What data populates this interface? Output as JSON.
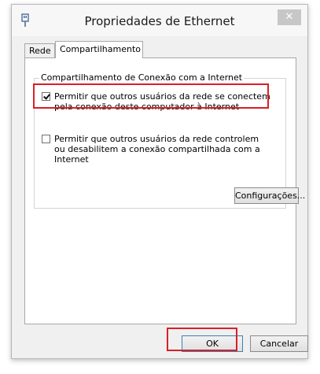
{
  "window": {
    "title": "Propriedades de Ethernet",
    "close_icon": "close-icon"
  },
  "tabs": [
    {
      "label": "Rede"
    },
    {
      "label": "Compartilhamento",
      "active": true
    }
  ],
  "group": {
    "legend": "Compartilhamento de Conexão com a Internet",
    "option1": {
      "checked": true,
      "label": "Permitir que outros usuários da rede se conectem pela conexão deste computador à Internet"
    },
    "option2": {
      "checked": false,
      "label": "Permitir que outros usuários da rede controlem ou desabilitem a conexão compartilhada com a Internet"
    },
    "settings_button": "Configurações..."
  },
  "footer": {
    "ok_label": "OK",
    "cancel_label": "Cancelar"
  },
  "colors": {
    "highlight": "#d91f26",
    "window_bg": "#f0f0f0"
  }
}
